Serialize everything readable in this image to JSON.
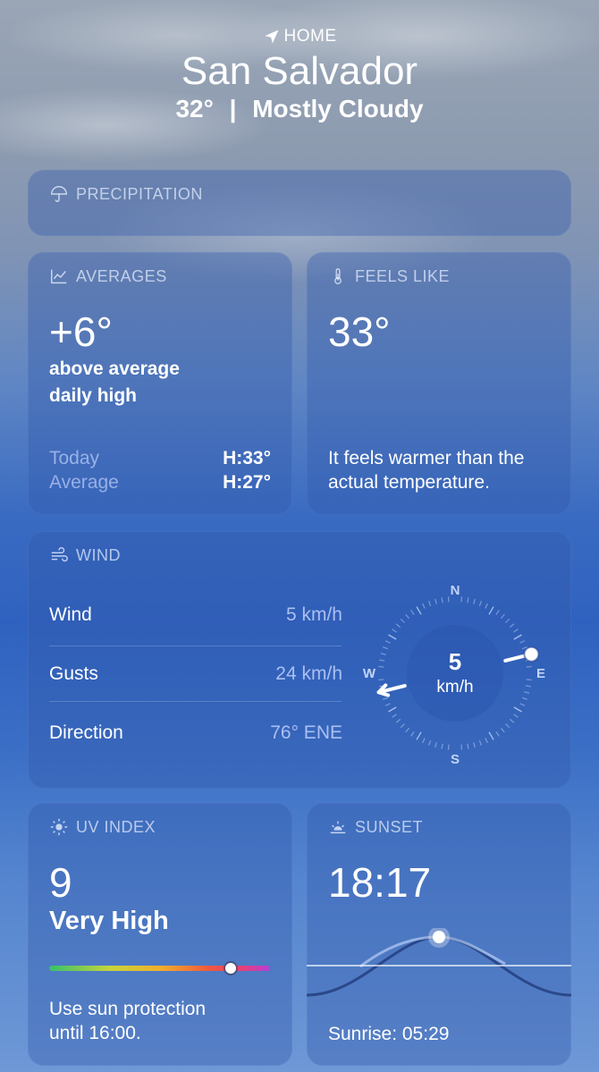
{
  "header": {
    "location_tag": "HOME",
    "city": "San Salvador",
    "temp": "32°",
    "separator": "|",
    "condition": "Mostly Cloudy"
  },
  "precipitation": {
    "title": "PRECIPITATION"
  },
  "averages": {
    "title": "AVERAGES",
    "value": "+6°",
    "desc_line1": "above average",
    "desc_line2": "daily high",
    "rows": [
      {
        "label": "Today",
        "value": "H:33°"
      },
      {
        "label": "Average",
        "value": "H:27°"
      }
    ]
  },
  "feels_like": {
    "title": "FEELS LIKE",
    "value": "33°",
    "desc_line1": "It feels warmer than the",
    "desc_line2": "actual temperature."
  },
  "wind": {
    "title": "WIND",
    "rows": [
      {
        "label": "Wind",
        "value": "5 km/h"
      },
      {
        "label": "Gusts",
        "value": "24 km/h"
      },
      {
        "label": "Direction",
        "value": "76° ENE"
      }
    ],
    "compass": {
      "speed": "5",
      "unit": "km/h",
      "n": "N",
      "e": "E",
      "s": "S",
      "w": "W",
      "direction_deg": 76
    }
  },
  "uv_index": {
    "title": "UV INDEX",
    "value": "9",
    "level": "Very High",
    "level_fraction": 0.82,
    "desc_line1": "Use sun protection",
    "desc_line2": "until 16:00."
  },
  "sunset": {
    "title": "SUNSET",
    "time": "18:17",
    "sunrise": "Sunrise: 05:29"
  },
  "colors": {
    "card_bg": "#325aaa",
    "accent_text": "#c8d7ff"
  },
  "icons": {
    "location": "location-arrow-icon",
    "precipitation": "umbrella-icon",
    "averages": "chart-line-icon",
    "feels_like": "thermometer-icon",
    "wind": "wind-icon",
    "uv": "sun-icon",
    "sunset": "sunset-icon"
  }
}
